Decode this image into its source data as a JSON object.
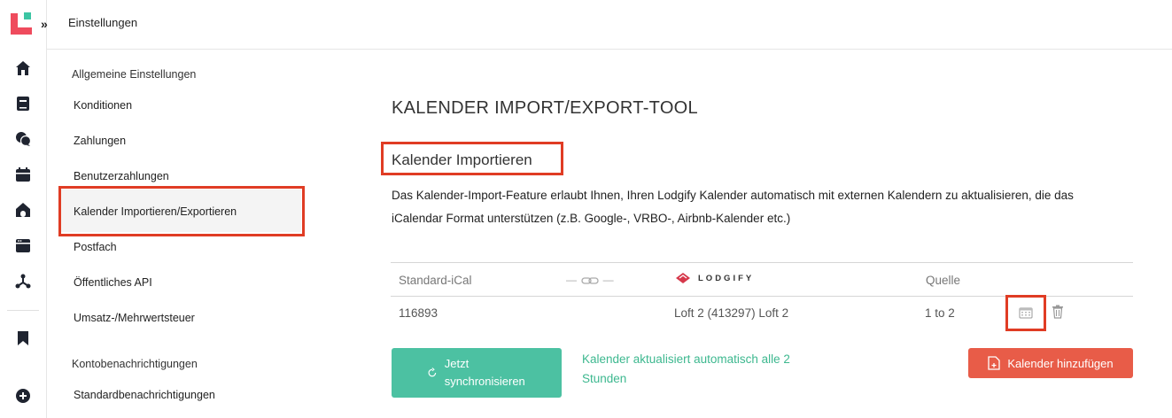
{
  "topbar": {
    "title": "Einstellungen"
  },
  "rail": {
    "icons": [
      "home-icon",
      "book-icon",
      "chat-icon",
      "calendar-icon",
      "house-icon",
      "browser-icon",
      "network-icon",
      "bookmark-icon",
      "plus-circle-icon"
    ]
  },
  "nav": {
    "group1": "Allgemeine Einstellungen",
    "items1": [
      "Konditionen",
      "Zahlungen",
      "Benutzerzahlungen",
      "Kalender Importieren/Exportieren",
      "Postfach",
      "Öffentliches API",
      "Umsatz-/Mehrwertsteuer"
    ],
    "group2": "Kontobenachrichtigungen",
    "items2": [
      "Standardbenachrichtigungen"
    ],
    "active": "Kalender Importieren/Exportieren"
  },
  "main": {
    "title": "KALENDER IMPORT/EXPORT-TOOL",
    "section_title": "Kalender Importieren",
    "description": "Das Kalender-Import-Feature erlaubt Ihnen, Ihren Lodgify Kalender automatisch mit externen Kalendern zu aktualisieren, die das iCalendar Format unterstützen (z.B. Google-, VRBO-, Airbnb-Kalender etc.)",
    "table": {
      "headers": {
        "ical": "Standard-iCal",
        "brand": "LODGIFY",
        "source": "Quelle"
      },
      "rows": [
        {
          "ical": "116893",
          "property": "Loft 2 (413297) Loft 2",
          "source": "1 to 2"
        }
      ]
    },
    "sync_button": "Jetzt synchronisieren",
    "sync_note": "Kalender aktualisiert automatisch alle 2 Stunden",
    "add_button": "Kalender hinzufügen"
  },
  "colors": {
    "accent_red": "#e85c48",
    "highlight": "#e03c24",
    "teal": "#4cc1a2",
    "teal_text": "#3db88f"
  }
}
